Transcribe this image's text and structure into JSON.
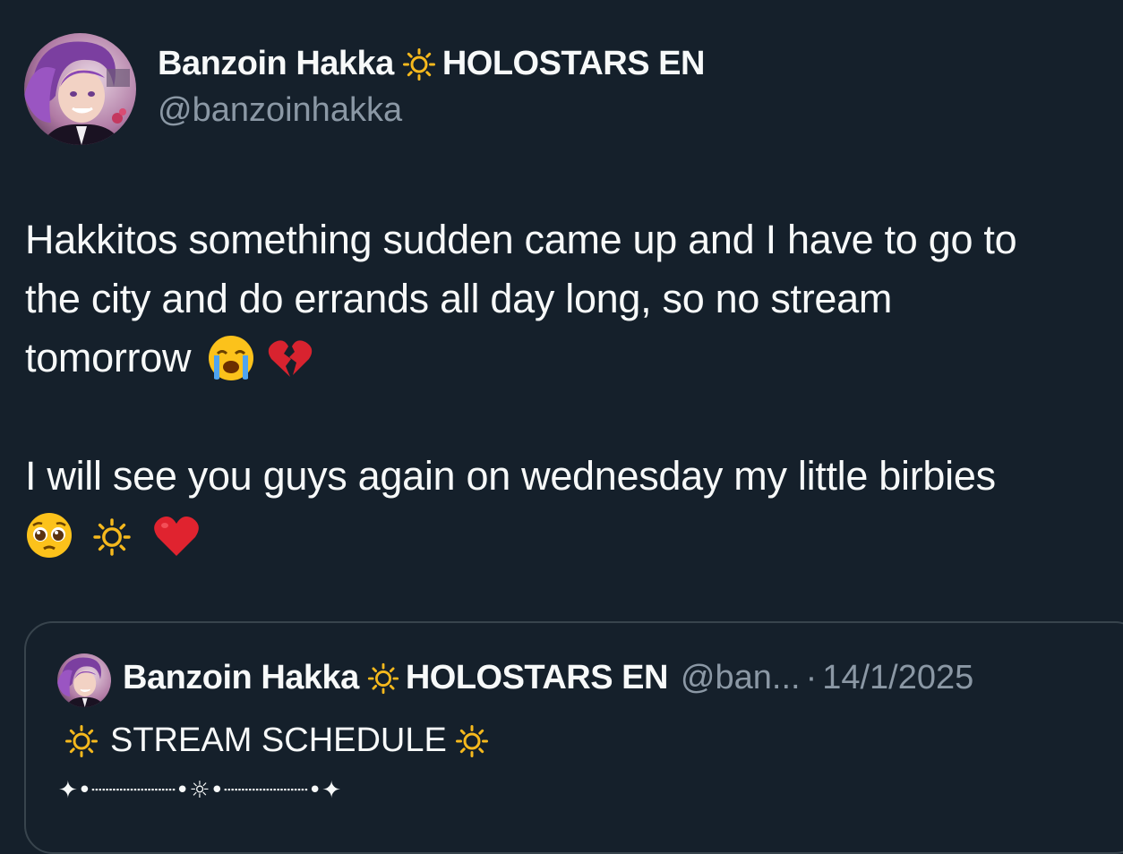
{
  "tweet": {
    "author": {
      "display_name": "Banzoin Hakka",
      "name_suffix": "HOLOSTARS EN",
      "handle": "@banzoinhakka",
      "name_icon": "sun-icon"
    },
    "body": {
      "line1": "Hakkitos something sudden came up and I have to go to",
      "line2": "the city and do errands all day long, so no stream",
      "line3": "tomorrow",
      "line3_emojis": [
        "loudly-crying-face-emoji",
        "broken-heart-emoji"
      ],
      "line4": "I will see you guys again on wednesday my little birbies",
      "line5_emojis": [
        "pleading-face-emoji",
        "sun-emoji",
        "red-heart-emoji"
      ]
    }
  },
  "quote": {
    "display_name": "Banzoin Hakka",
    "name_suffix": "HOLOSTARS EN",
    "handle": "@ban...",
    "separator": "·",
    "date": "14/1/2025",
    "line1": "STREAM SCHEDULE",
    "line2": "✦•┈┈┈┈┈┈•☼•┈┈┈┈┈┈•✦"
  },
  "colors": {
    "background": "#15202b",
    "text_primary": "#f7f9f9",
    "text_secondary": "#8b98a5",
    "border": "#38444d"
  }
}
